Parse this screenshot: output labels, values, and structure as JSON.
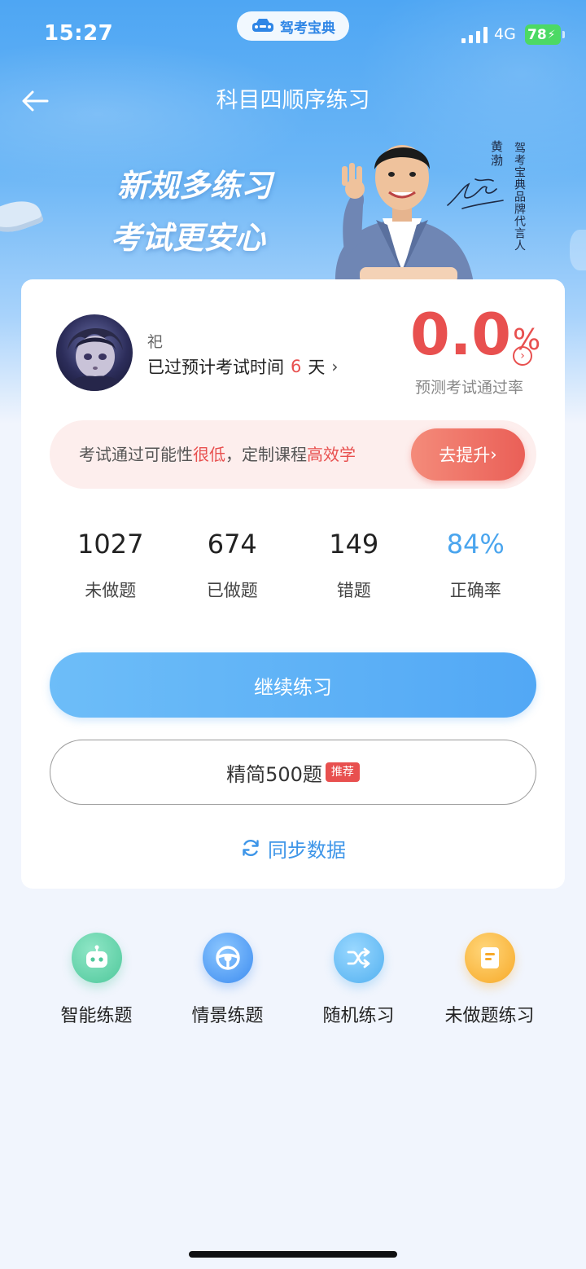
{
  "status_bar": {
    "time": "15:27",
    "app_pill": "驾考宝典",
    "network": "4G",
    "battery": "78"
  },
  "nav": {
    "title": "科目四顺序练习"
  },
  "banner": {
    "slogan_line1": "新规多练习",
    "slogan_line2": "考试更安心",
    "spokesperson_name": "黄渤",
    "spokesperson_title": "驾考宝典品牌代言人"
  },
  "profile": {
    "username": "祀",
    "exam_prefix": "已过预计考试时间",
    "exam_days": "6",
    "exam_unit": "天",
    "pass_rate_value": "0.0",
    "pass_rate_unit": "%",
    "pass_rate_label": "预测考试通过率"
  },
  "upgrade": {
    "text_part1": "考试通过可能性",
    "text_red1": "很低",
    "text_part2": "，定制课程",
    "text_red2": "高效学",
    "button_label": "去提升"
  },
  "stats": [
    {
      "value": "1027",
      "label": "未做题"
    },
    {
      "value": "674",
      "label": "已做题"
    },
    {
      "value": "149",
      "label": "错题"
    },
    {
      "value": "84%",
      "label": "正确率"
    }
  ],
  "actions": {
    "continue_label": "继续练习",
    "simplified_label": "精简500题",
    "recommend_badge": "推荐",
    "sync_label": "同步数据"
  },
  "features": [
    {
      "label": "智能练题",
      "icon": "robot-icon"
    },
    {
      "label": "情景练题",
      "icon": "steering-wheel-icon"
    },
    {
      "label": "随机练习",
      "icon": "shuffle-icon"
    },
    {
      "label": "未做题练习",
      "icon": "document-icon"
    }
  ],
  "colors": {
    "accent_blue": "#52a8f5",
    "alert_red": "#e8504f",
    "battery_green": "#4cd964"
  }
}
